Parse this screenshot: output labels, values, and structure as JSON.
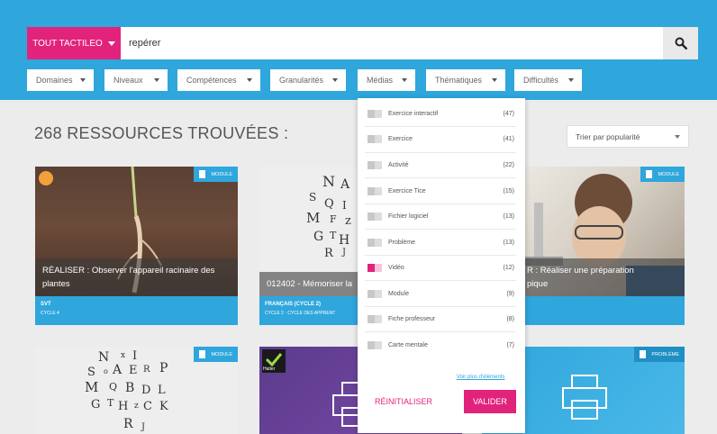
{
  "search": {
    "scope_label": "TOUT TACTILEO",
    "query": "repérer"
  },
  "filters": [
    {
      "label": "Domaines"
    },
    {
      "label": "Niveaux"
    },
    {
      "label": "Compétences"
    },
    {
      "label": "Granularités"
    },
    {
      "label": "Médias"
    },
    {
      "label": "Thématiques"
    },
    {
      "label": "Difficultés"
    }
  ],
  "results": {
    "title": "268 RESSOURCES TROUVÉES :",
    "sort_label": "Trier par popularité"
  },
  "cards": [
    {
      "title": "RÉALISER : Observer l'appareil racinaire des plantes",
      "badge": "MODULE",
      "subject": "SVT",
      "level": "CYCLE 4"
    },
    {
      "title": "012402 - Mémoriser la",
      "badge": "",
      "subject": "FRANÇAIS (CYCLE 2)",
      "level": "CYCLE 2 · CYCLE DES APPRENT"
    },
    {
      "title": "R : Réaliser une préparation\npique",
      "badge": "MODULE",
      "subject": "",
      "level": ""
    },
    {
      "title": "",
      "badge": "MODULE",
      "subject": "",
      "level": ""
    },
    {
      "title": "",
      "badge": "",
      "subject": "",
      "level": "",
      "logo": "Hatier"
    },
    {
      "title": "",
      "badge": "PROBLÈME",
      "subject": "",
      "level": ""
    }
  ],
  "media_dropdown": {
    "items": [
      {
        "label": "Exercice interactif",
        "count": "(47)",
        "checked": false
      },
      {
        "label": "Exercice",
        "count": "(41)",
        "checked": false
      },
      {
        "label": "Activité",
        "count": "(22)",
        "checked": false
      },
      {
        "label": "Exercice Tice",
        "count": "(15)",
        "checked": false
      },
      {
        "label": "Fichier logiciel",
        "count": "(13)",
        "checked": false
      },
      {
        "label": "Problème",
        "count": "(13)",
        "checked": false
      },
      {
        "label": "Vidéo",
        "count": "(12)",
        "checked": true
      },
      {
        "label": "Module",
        "count": "(9)",
        "checked": false
      },
      {
        "label": "Fiche professeur",
        "count": "(8)",
        "checked": false
      },
      {
        "label": "Carte mentale",
        "count": "(7)",
        "checked": false
      }
    ],
    "more_label": "Voir plus d'éléments",
    "reset_label": "RÉINITIALISER",
    "validate_label": "VALIDER"
  },
  "colors": {
    "primary": "#2fa6dc",
    "accent": "#e2237b",
    "background": "#ececec"
  },
  "icons": {
    "search": "magnifier-icon",
    "dropdown": "chevron-down-icon",
    "document": "document-icon",
    "printer": "printer-icon"
  }
}
